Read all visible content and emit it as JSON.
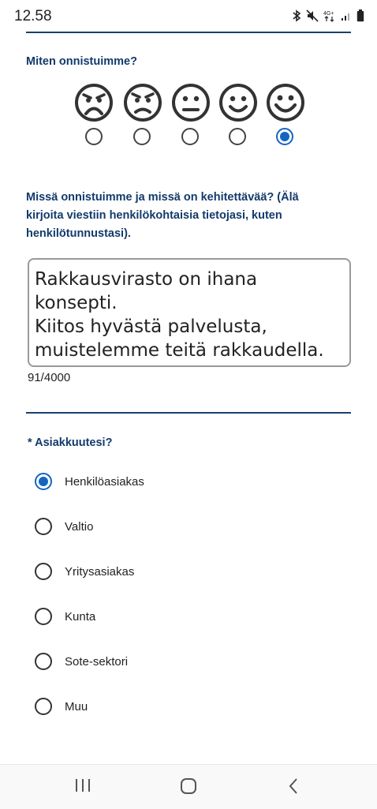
{
  "status": {
    "time": "12.58",
    "icons": [
      "bluetooth-icon",
      "mute-icon",
      "4g-icon",
      "signal-icon",
      "battery-icon"
    ],
    "network_label": "4G+"
  },
  "rating": {
    "question": "Miten onnistuimme?",
    "faces": [
      "very-sad-face-icon",
      "sad-face-icon",
      "neutral-face-icon",
      "happy-face-icon",
      "very-happy-face-icon"
    ],
    "selected_index": 4
  },
  "feedback": {
    "question_line1": "Missä onnistuimme ja missä on kehitettävää? (Älä",
    "question_line2": "kirjoita viestiin henkilökohtaisia tietojasi, kuten",
    "question_line3": "henkilötunnustasi).",
    "text_line1": "Rakkausvirasto on ihana konsepti.",
    "text_line2": "Kiitos hyvästä palvelusta,",
    "text_line3": "muistelemme teitä rakkaudella.",
    "counter": "91/4000"
  },
  "customer": {
    "question": "* Asiakkuutesi?",
    "options": [
      {
        "label": "Henkilöasiakas",
        "selected": true
      },
      {
        "label": "Valtio",
        "selected": false
      },
      {
        "label": "Yritysasiakas",
        "selected": false
      },
      {
        "label": "Kunta",
        "selected": false
      },
      {
        "label": "Sote-sektori",
        "selected": false
      },
      {
        "label": "Muu",
        "selected": false
      }
    ]
  },
  "navbar": {
    "buttons": [
      "recent-apps-icon",
      "home-icon",
      "back-icon"
    ]
  },
  "colors": {
    "accent": "#1565c0",
    "heading": "#123a6b",
    "divider": "#1c3f6e"
  }
}
